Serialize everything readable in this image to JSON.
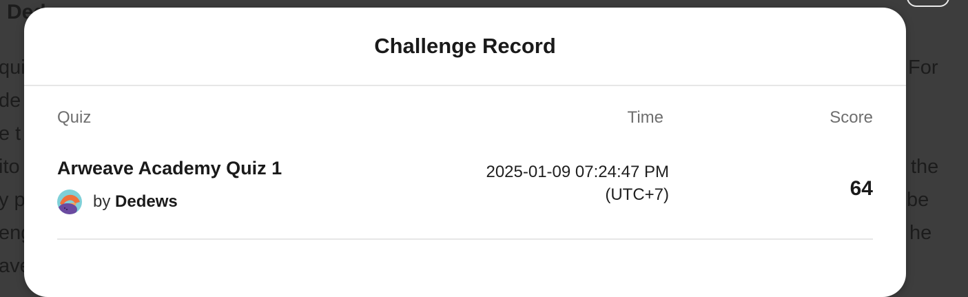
{
  "background": {
    "heading": "Dedu",
    "left_fragments": [
      "quiz",
      "de",
      "e t",
      "ito",
      "y p",
      "eng",
      "ave"
    ],
    "right_fragments": [
      "For",
      "",
      "",
      "the",
      "be",
      "he",
      ""
    ]
  },
  "modal": {
    "title": "Challenge Record",
    "columns": {
      "quiz": "Quiz",
      "time": "Time",
      "score": "Score"
    },
    "record": {
      "quiz_title": "Arweave Academy Quiz 1",
      "by_label": "by",
      "author": "Dedews",
      "date_time": "2025-01-09 07:24:47 PM",
      "timezone": "(UTC+7)",
      "score": "64"
    }
  },
  "colors": {
    "overlay": "#3d3d3d",
    "modal_bg": "#ffffff",
    "header_text": "#6e6e6e",
    "avatar_teal": "#7fd0d8",
    "avatar_orange": "#f0703a",
    "avatar_purple": "#6b4aa0"
  },
  "icons": {
    "avatar": "user-avatar-illustration"
  }
}
